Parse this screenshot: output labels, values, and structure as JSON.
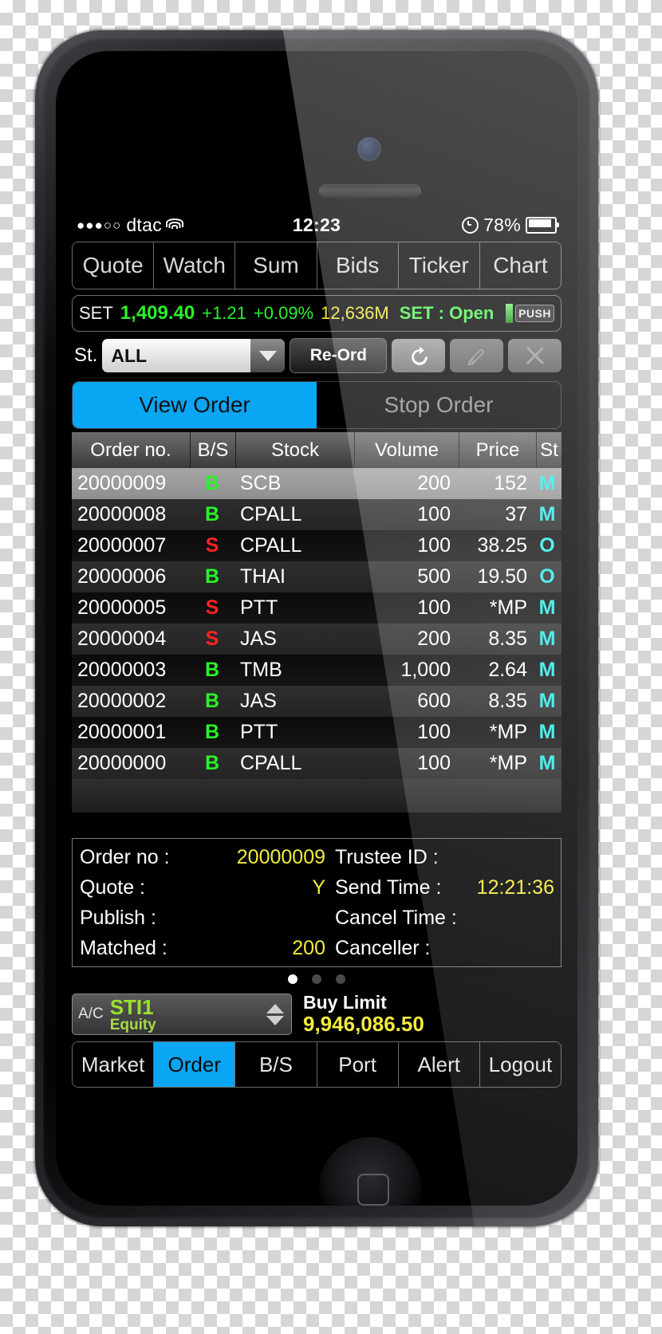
{
  "status_bar": {
    "signal_dots": "●●●○○",
    "carrier": "dtac",
    "wifi_icon": "wifi-icon",
    "time": "12:23",
    "alarm_icon": "alarm-icon",
    "battery_percent": "78%",
    "battery_icon": "battery-icon"
  },
  "top_tabs": [
    {
      "label": "Quote"
    },
    {
      "label": "Watch"
    },
    {
      "label": "Sum"
    },
    {
      "label": "Bids"
    },
    {
      "label": "Ticker"
    },
    {
      "label": "Chart"
    }
  ],
  "market_bar": {
    "name": "SET",
    "index": "1,409.40",
    "change": "+1.21",
    "percent": "+0.09%",
    "volume": "12,636M",
    "status": "SET : Open",
    "push_label": "PUSH"
  },
  "filter_bar": {
    "st_label": "St.",
    "st_value": "ALL",
    "st_placeholder": "ALL",
    "reorder_label": "Re-Ord",
    "refresh_icon": "refresh-icon",
    "edit_icon": "pencil-icon",
    "close_icon": "close-icon"
  },
  "segment": {
    "view_order": "View Order",
    "stop_order": "Stop Order",
    "active": "View Order"
  },
  "table": {
    "columns": [
      "Order no.",
      "B/S",
      "Stock",
      "Volume",
      "Price",
      "St"
    ],
    "rows": [
      {
        "order_no": "20000009",
        "bs": "B",
        "stock": "SCB",
        "volume": "200",
        "price": "152",
        "st": "M",
        "selected": true
      },
      {
        "order_no": "20000008",
        "bs": "B",
        "stock": "CPALL",
        "volume": "100",
        "price": "37",
        "st": "M",
        "selected": false
      },
      {
        "order_no": "20000007",
        "bs": "S",
        "stock": "CPALL",
        "volume": "100",
        "price": "38.25",
        "st": "O",
        "selected": false
      },
      {
        "order_no": "20000006",
        "bs": "B",
        "stock": "THAI",
        "volume": "500",
        "price": "19.50",
        "st": "O",
        "selected": false
      },
      {
        "order_no": "20000005",
        "bs": "S",
        "stock": "PTT",
        "volume": "100",
        "price": "*MP",
        "st": "M",
        "selected": false
      },
      {
        "order_no": "20000004",
        "bs": "S",
        "stock": "JAS",
        "volume": "200",
        "price": "8.35",
        "st": "M",
        "selected": false
      },
      {
        "order_no": "20000003",
        "bs": "B",
        "stock": "TMB",
        "volume": "1,000",
        "price": "2.64",
        "st": "M",
        "selected": false
      },
      {
        "order_no": "20000002",
        "bs": "B",
        "stock": "JAS",
        "volume": "600",
        "price": "8.35",
        "st": "M",
        "selected": false
      },
      {
        "order_no": "20000001",
        "bs": "B",
        "stock": "PTT",
        "volume": "100",
        "price": "*MP",
        "st": "M",
        "selected": false
      },
      {
        "order_no": "20000000",
        "bs": "B",
        "stock": "CPALL",
        "volume": "100",
        "price": "*MP",
        "st": "M",
        "selected": false
      }
    ]
  },
  "detail": {
    "rows": [
      {
        "label_left": "Order no :",
        "value_left": "20000009",
        "label_right": "Trustee ID :",
        "value_right": ""
      },
      {
        "label_left": "Quote :",
        "value_left": "Y",
        "label_right": "Send Time :",
        "value_right": "12:21:36"
      },
      {
        "label_left": "Publish :",
        "value_left": "",
        "label_right": "Cancel Time :",
        "value_right": ""
      },
      {
        "label_left": "Matched :",
        "value_left": "200",
        "label_right": "Canceller :",
        "value_right": ""
      }
    ],
    "page_dots": 3,
    "active_dot": 1
  },
  "account": {
    "ac_label": "A/C",
    "name": "STI1",
    "type": "Equity",
    "stepper_icon": "stepper-up-down-icon",
    "buy_limit_label": "Buy Limit",
    "buy_limit_value": "9,946,086.50"
  },
  "bottom_nav": [
    {
      "label": "Market",
      "active": false
    },
    {
      "label": "Order",
      "active": true
    },
    {
      "label": "B/S",
      "active": false
    },
    {
      "label": "Port",
      "active": false
    },
    {
      "label": "Alert",
      "active": false
    },
    {
      "label": "Logout",
      "active": false
    }
  ],
  "colors": {
    "accent_blue": "#09a6f3",
    "up_green": "#2bf12b",
    "down_red": "#ff2222",
    "yellow": "#f2ec3c",
    "status_cyan": "#2ee8e8",
    "account_green": "#9ce22c"
  }
}
